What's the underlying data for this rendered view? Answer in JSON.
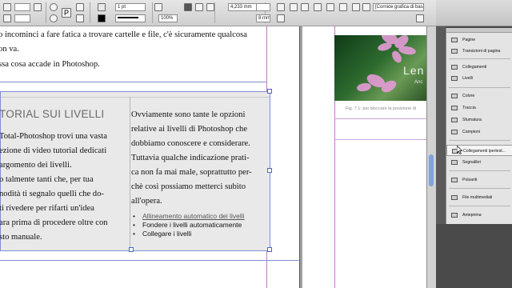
{
  "control_bar": {
    "field_1": "1 pt",
    "field_2": "100%",
    "field_3": "4,233 mm",
    "field_4": "8 mm",
    "field_5": "1",
    "style_select": "[Cornice grafica di base]+"
  },
  "panel": {
    "items": [
      {
        "label": "Pagine"
      },
      {
        "label": "Transizioni di pagina"
      },
      {
        "label": "Collegamenti"
      },
      {
        "label": "Livelli"
      },
      {
        "label": "Colore"
      },
      {
        "label": "Traccia"
      },
      {
        "label": "Sfumatura"
      },
      {
        "label": "Campioni"
      },
      {
        "label": "Collegamenti ipertest..."
      },
      {
        "label": "Segnalibri"
      },
      {
        "label": "Pulsanti"
      },
      {
        "label": "File multimediali"
      },
      {
        "label": "Anteprima"
      }
    ]
  },
  "document": {
    "top_lines": [
      "o incominci a fare fatica a trovare cartelle e file, c'è sicuramente qualcosa",
      "on va.",
      "ssa cosa accade in Photoshop."
    ],
    "box_heading": "TORIAL SUI LIVELLI",
    "left_col": [
      "Total-Photoshop trovi una vasta",
      "ezione di video tutorial dedicati",
      "argomento dei livelli.",
      "o talmente tanti che, per tua",
      "nodità ti segnalo quelli che do-",
      "ti rivedere per rifarti un'idea",
      "ara prima di procedere oltre con",
      "sto manuale."
    ],
    "right_col": [
      "Ovviamente sono tante le opzioni",
      "relative ai livelli di Photoshop che",
      "dobbiamo conoscere e considerare.",
      "Tuttavia qualche indicazione prati-",
      "ca non fa mai male, soprattutto per-",
      "chè così possiamo metterci subito",
      "all'opera."
    ],
    "bullets": [
      "Allineamento automatico dei livelli",
      "Fondere i livelli automaticamente",
      "Collegare i livelli"
    ],
    "photo_text": "Len",
    "photo_subtext": "Anc",
    "caption": "Fig. 7.1: per bloccare la posizione di"
  }
}
